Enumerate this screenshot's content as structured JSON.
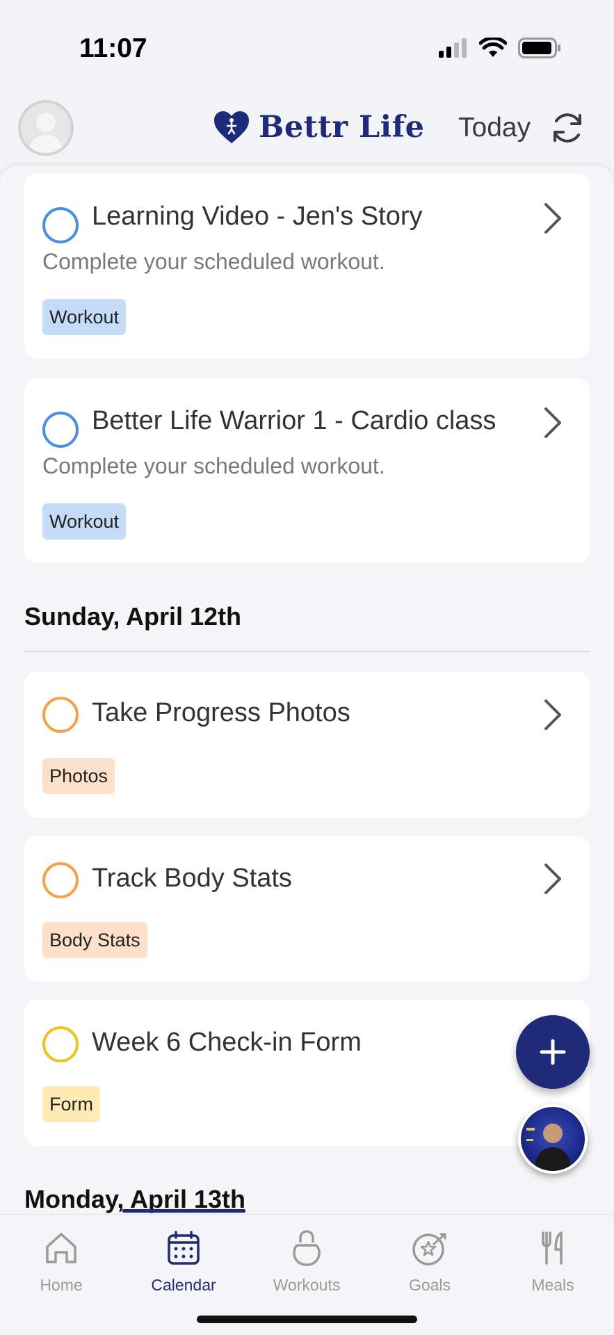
{
  "status_bar": {
    "time": "11:07"
  },
  "header": {
    "logo_text": "Bettr Life",
    "today_label": "Today",
    "brand_color": "#1f2a78"
  },
  "feed": {
    "cards_top": [
      {
        "title": "Learning Video - Jen's Story",
        "subtitle": "Complete your scheduled workout.",
        "tag": "Workout"
      },
      {
        "title": "Better Life Warrior 1 - Cardio class",
        "subtitle": "Complete your scheduled workout.",
        "tag": "Workout"
      }
    ],
    "day_sunday": {
      "heading": "Sunday, April 12th",
      "cards": [
        {
          "title": "Take Progress Photos",
          "tag": "Photos"
        },
        {
          "title": "Track Body Stats",
          "tag": "Body Stats"
        },
        {
          "title": "Week 6 Check-in Form",
          "tag": "Form"
        }
      ]
    },
    "day_monday": {
      "heading": "Monday, April 13th"
    }
  },
  "tabs": [
    {
      "label": "Home",
      "icon": "home-icon"
    },
    {
      "label": "Calendar",
      "icon": "calendar-icon"
    },
    {
      "label": "Workouts",
      "icon": "kettlebell-icon"
    },
    {
      "label": "Goals",
      "icon": "goals-icon"
    },
    {
      "label": "Meals",
      "icon": "utensils-icon"
    }
  ],
  "active_tab": "Calendar",
  "colors": {
    "workout_circle": "#4a90e2",
    "orange_circle": "#f5a04a",
    "yellow_circle": "#f2c21b"
  }
}
